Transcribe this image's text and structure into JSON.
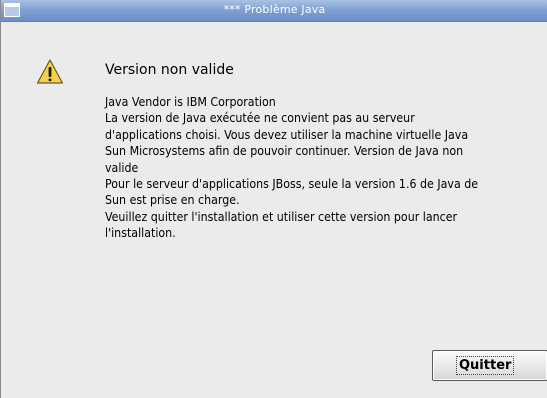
{
  "window": {
    "title": "*** Problème Java"
  },
  "dialog": {
    "icon": "warning-icon",
    "heading": "Version non valide",
    "lines": [
      "Java Vendor is IBM Corporation",
      "La version de Java exécutée ne convient pas au serveur",
      "d'applications choisi. Vous devez utiliser la machine virtuelle Java",
      "Sun Microsystems afin de pouvoir continuer. Version de Java non",
      "valide",
      "Pour le serveur d'applications JBoss, seule la version 1.6 de Java de",
      "Sun est prise en charge.",
      "Veuillez quitter l'installation et utiliser cette version pour lancer",
      "l'installation."
    ],
    "button_label": "Quitter"
  },
  "colors": {
    "titlebar": "#7f9ed0",
    "background": "#ebebeb",
    "warning_fill": "#f5d04a"
  }
}
